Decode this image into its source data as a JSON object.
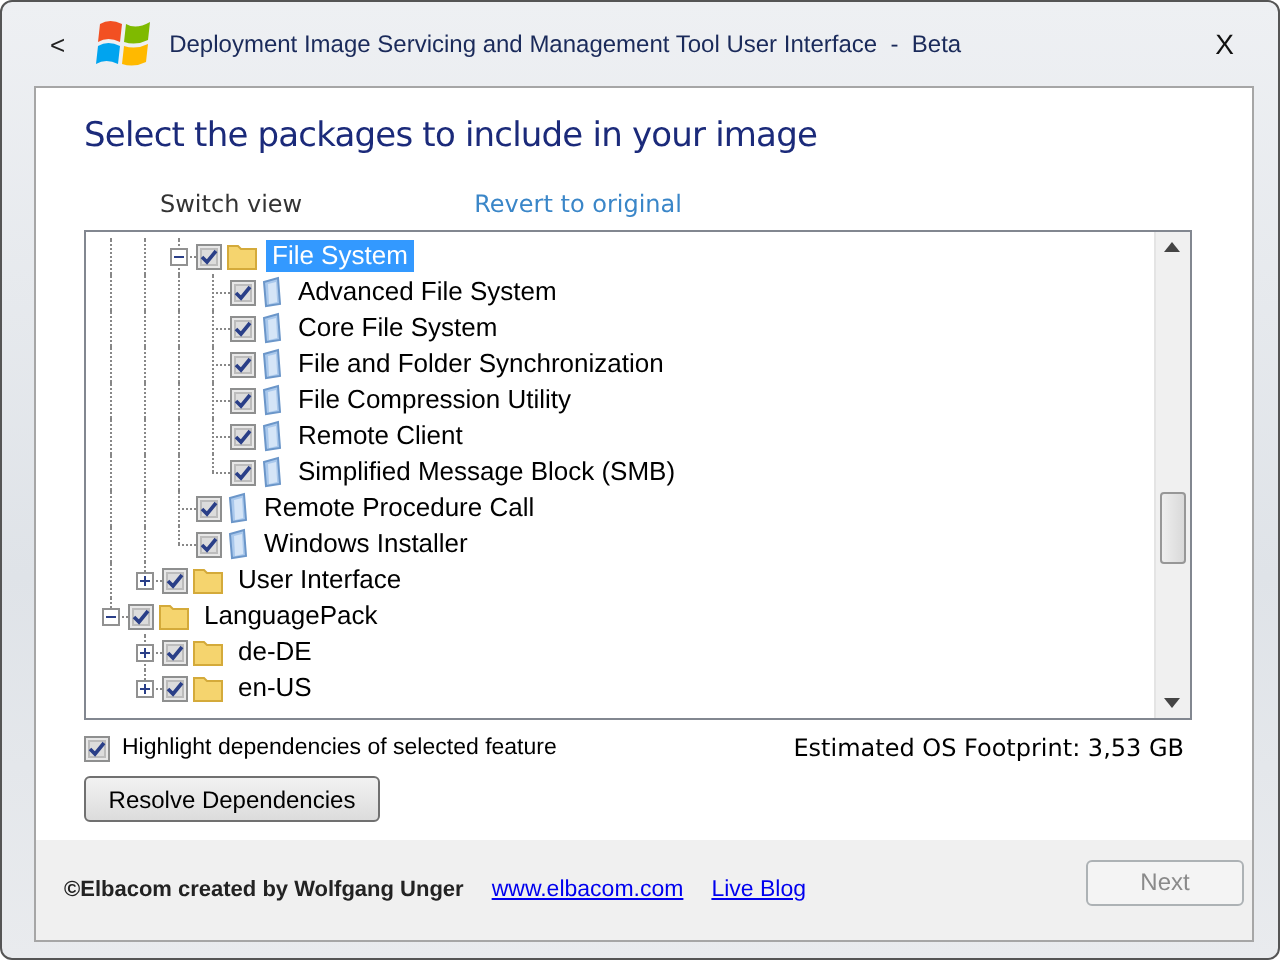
{
  "window": {
    "title": "Deployment Image Servicing and Management Tool User Interface  -  Beta",
    "back": "<",
    "close": "X"
  },
  "heading": "Select the packages to include in your image",
  "links": [
    {
      "label": "Switch view",
      "kind": "plain"
    },
    {
      "label": "Revert to original",
      "kind": "accent"
    }
  ],
  "tree": {
    "items": [
      {
        "children": [
          {
            "children": [
              {
                "children": [
                  {
                    "label": "File System",
                    "kind": "folder",
                    "checked": true,
                    "selected": true,
                    "expanded": true,
                    "children": [
                      {
                        "label": "Advanced File System",
                        "kind": "package",
                        "checked": true,
                        "selected": false
                      },
                      {
                        "label": "Core File System",
                        "kind": "package",
                        "checked": true,
                        "selected": false
                      },
                      {
                        "label": "File and Folder Synchronization",
                        "kind": "package",
                        "checked": true,
                        "selected": false
                      },
                      {
                        "label": "File Compression Utility",
                        "kind": "package",
                        "checked": true,
                        "selected": false
                      },
                      {
                        "label": "Remote Client",
                        "kind": "package",
                        "checked": true,
                        "selected": false
                      },
                      {
                        "label": "Simplified Message Block (SMB)",
                        "kind": "package",
                        "checked": true,
                        "selected": false
                      }
                    ]
                  },
                  {
                    "label": "Remote Procedure Call",
                    "kind": "package",
                    "checked": true,
                    "selected": false
                  },
                  {
                    "label": "Windows Installer",
                    "kind": "package",
                    "checked": true,
                    "selected": false
                  }
                ]
              },
              {
                "label": "User Interface",
                "kind": "folder",
                "checked": true,
                "selected": false,
                "expanded": false
              }
            ]
          },
          {
            "label": "LanguagePack",
            "kind": "folder",
            "checked": true,
            "selected": false,
            "expanded": true,
            "children": [
              {
                "label": "de-DE",
                "kind": "folder",
                "checked": true,
                "selected": false,
                "expanded": false
              },
              {
                "label": "en-US",
                "kind": "folder",
                "checked": true,
                "selected": false,
                "expanded": false
              }
            ]
          }
        ]
      }
    ]
  },
  "highlight_option": {
    "label": "Highlight dependencies of selected feature",
    "checked": true
  },
  "footprint": "Estimated OS Footprint: 3,53 GB",
  "resolve_button": "Resolve Dependencies",
  "footer": {
    "credit": "©Elbacom created by Wolfgang Unger",
    "links": [
      "www.elbacom.com",
      "Live Blog"
    ]
  },
  "next_button": {
    "label": "Next",
    "disabled": true
  }
}
